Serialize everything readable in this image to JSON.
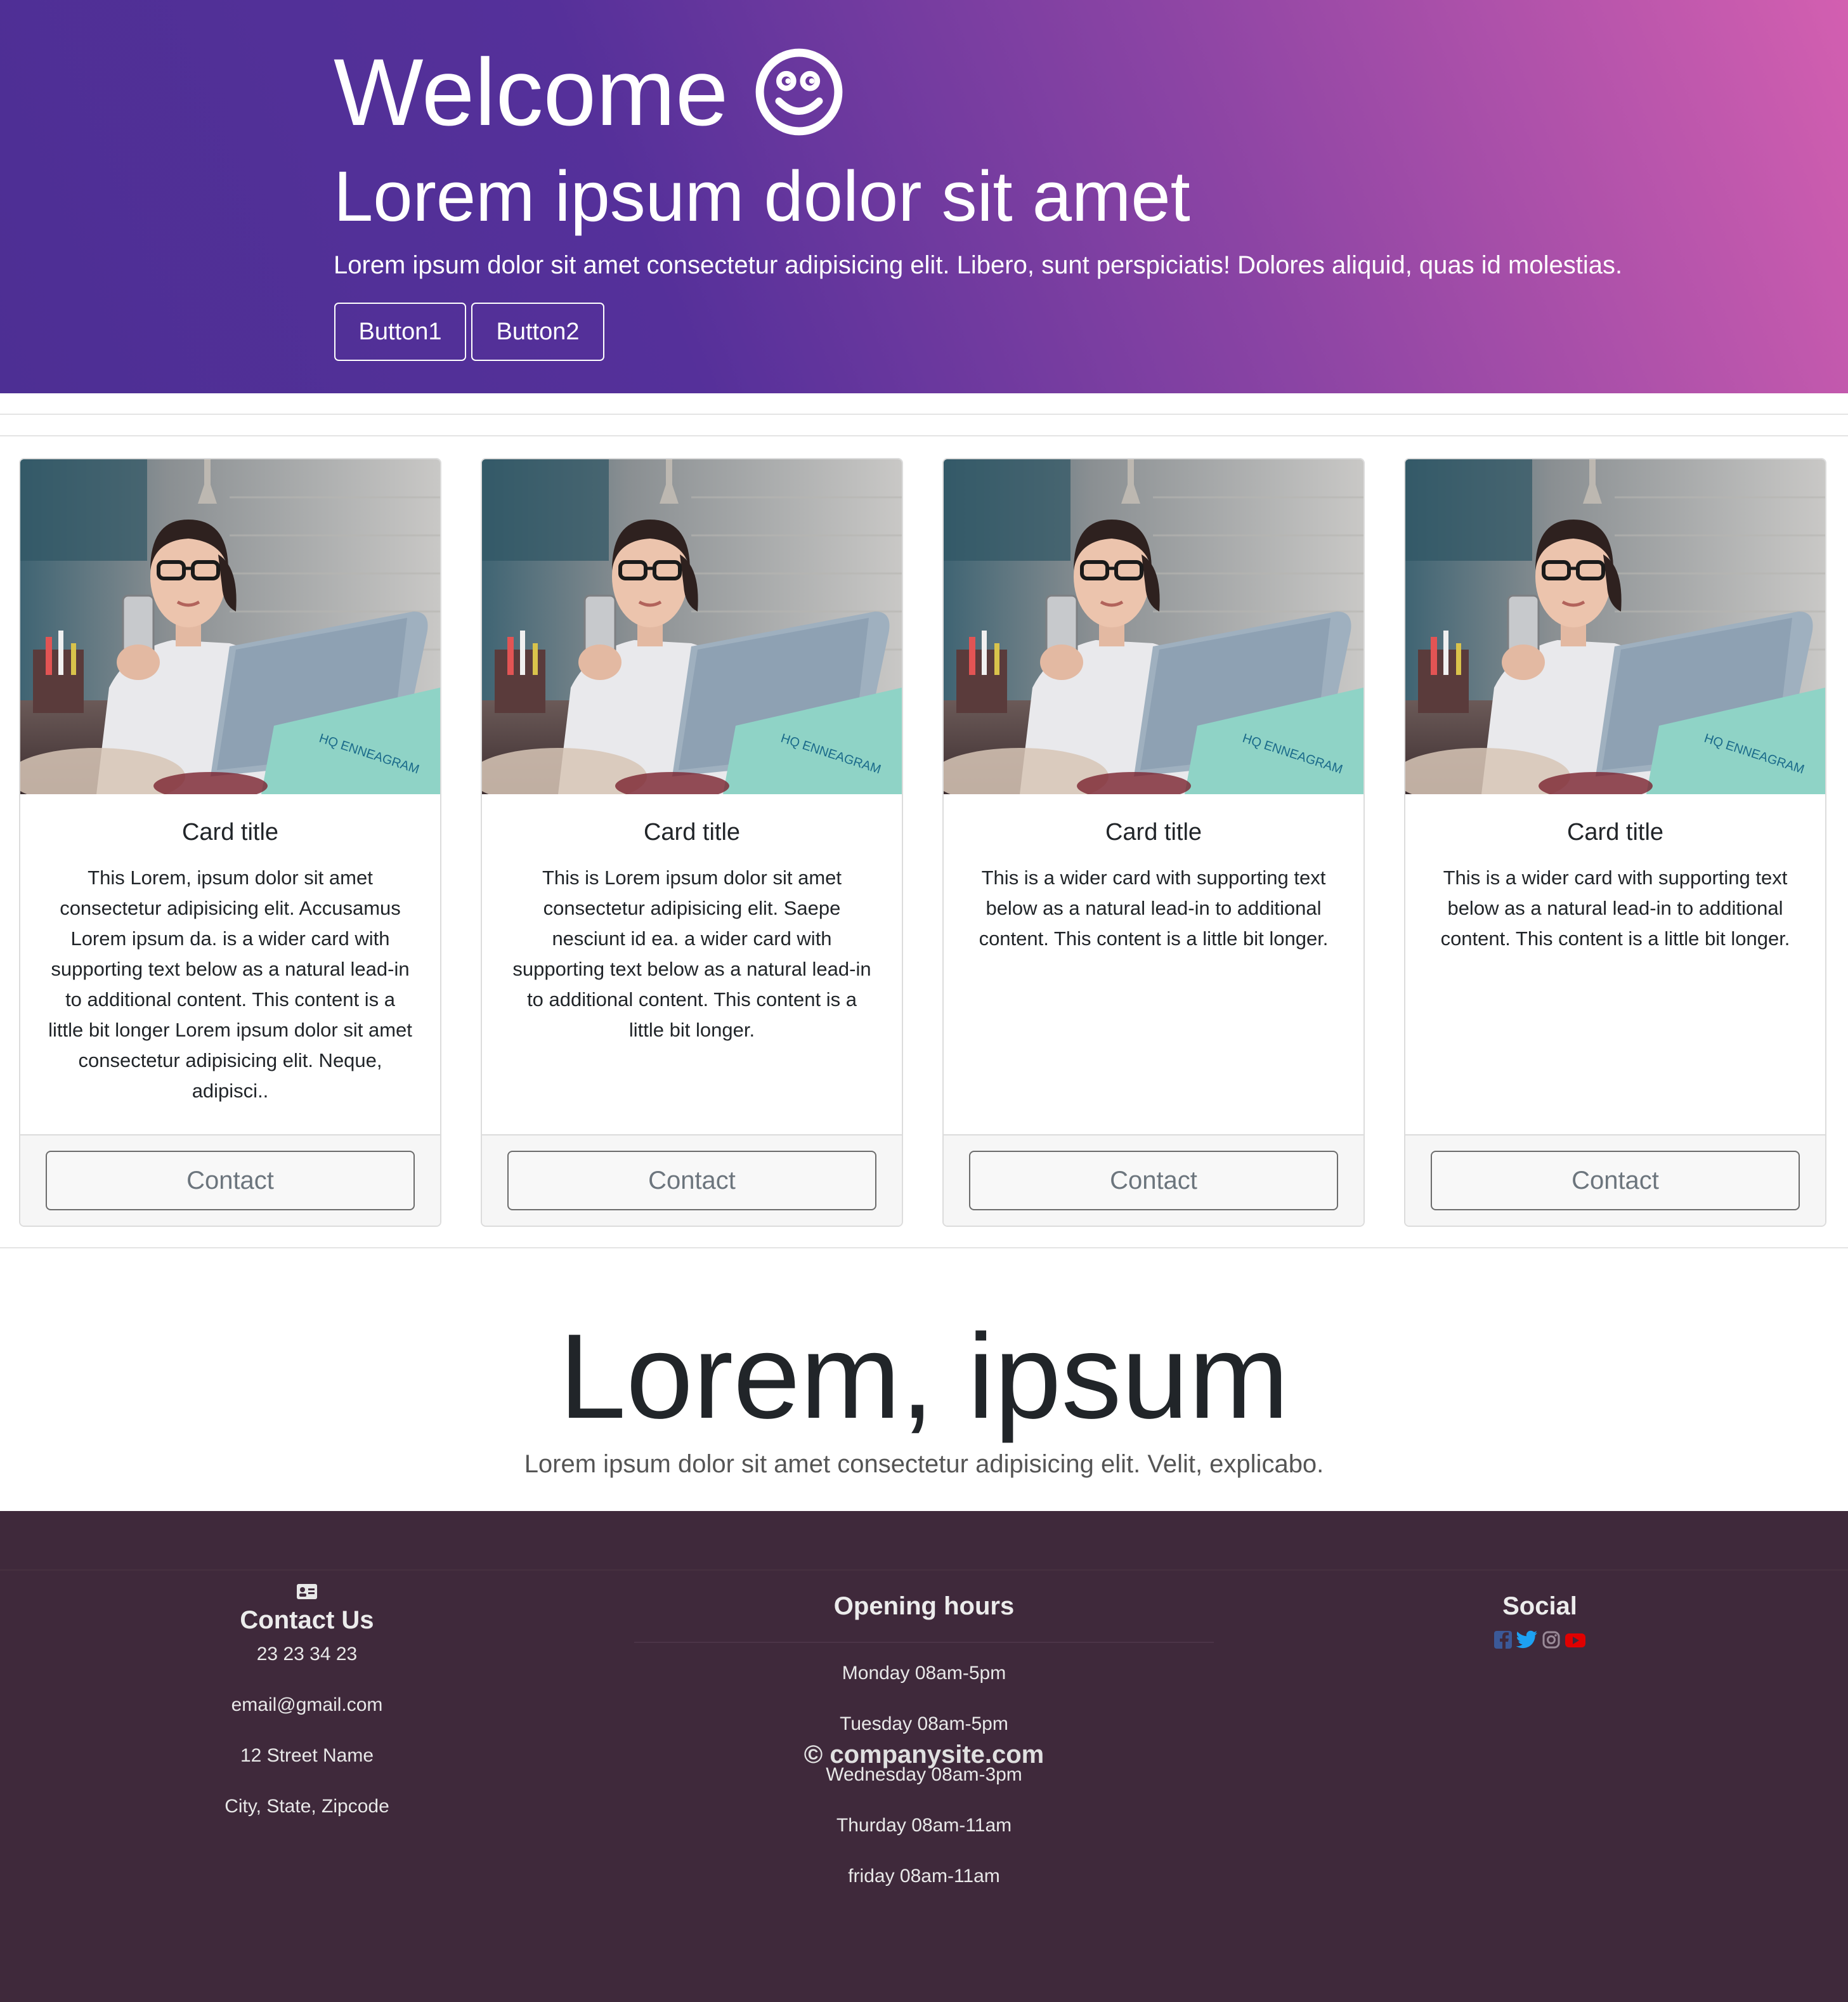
{
  "hero": {
    "title": "Welcome",
    "subtitle": "Lorem ipsum dolor sit amet",
    "text": "Lorem ipsum dolor sit amet consectetur adipisicing elit. Libero, sunt perspiciatis! Dolores aliquid, quas id molestias.",
    "button1": "Button1",
    "button2": "Button2"
  },
  "cards": [
    {
      "title": "Card title",
      "text": "This Lorem, ipsum dolor sit amet consectetur adipisicing elit. Accusamus Lorem ipsum da. is a wider card with supporting text below as a natural lead-in to additional content. This content is a little bit longer Lorem ipsum dolor sit amet consectetur adipisicing elit. Neque, adipisci..",
      "button": "Contact"
    },
    {
      "title": "Card title",
      "text": "This is Lorem ipsum dolor sit amet consectetur adipisicing elit. Saepe nesciunt id ea. a wider card with supporting text below as a natural lead-in to additional content. This content is a little bit longer.",
      "button": "Contact"
    },
    {
      "title": "Card title",
      "text": "This is a wider card with supporting text below as a natural lead-in to additional content. This content is a little bit longer.",
      "button": "Contact"
    },
    {
      "title": "Card title",
      "text": "This is a wider card with supporting text below as a natural lead-in to additional content. This content is a little bit longer.",
      "button": "Contact"
    }
  ],
  "section": {
    "title": "Lorem, ipsum",
    "lead": "Lorem ipsum dolor sit amet consectetur adipisicing elit. Velit, explicabo."
  },
  "footer": {
    "contact": {
      "heading": "Contact Us",
      "phone": "23 23 34 23",
      "email": "email@gmail.com",
      "street": "12 Street Name",
      "city": "City, State, Zipcode"
    },
    "hours": {
      "heading": "Opening hours",
      "items": [
        "Monday 08am-5pm",
        "Tuesday 08am-5pm",
        "Wednesday 08am-3pm",
        "Thurday 08am-11am",
        "friday 08am-11am"
      ]
    },
    "social": {
      "heading": "Social",
      "icons": [
        "facebook-icon",
        "twitter-icon",
        "instagram-icon",
        "youtube-icon"
      ]
    },
    "copyright": "© companysite.com"
  },
  "colors": {
    "hero_gradient_start": "#4d2f94",
    "hero_gradient_end": "#d35fb0",
    "footer_bg": "#3f293b",
    "facebook": "#3b5998",
    "twitter": "#1da1f2",
    "youtube": "#e00000"
  }
}
